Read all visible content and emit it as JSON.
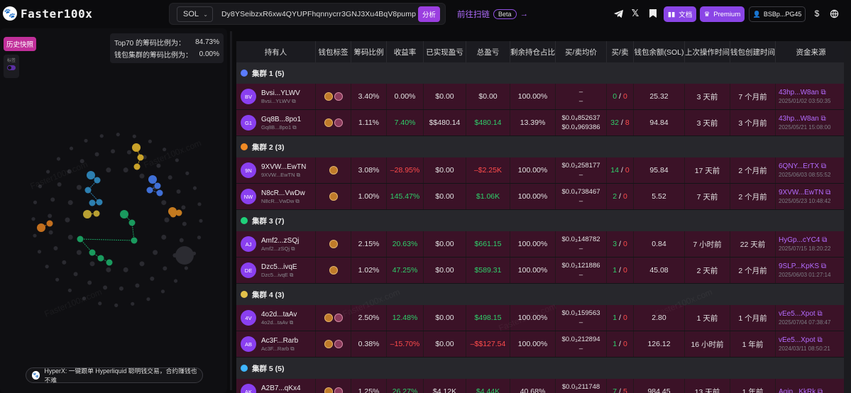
{
  "brand": {
    "name": "Faster100x"
  },
  "search": {
    "chain": "SOL",
    "address": "Dy8YSeibzxR6xw4QYUPFhqnnycrr3GNJ3Xu4BqV8pump",
    "analyze_label": "分析"
  },
  "scan": {
    "label": "前往扫链",
    "beta": "Beta"
  },
  "header": {
    "docs_label": "文档",
    "premium_label": "Premium",
    "wallet_label": "BSBp...PG45"
  },
  "left": {
    "history_label": "历史快照",
    "tag_label": "标签",
    "top70_label": "Top70 的筹码比例为：",
    "top70_value": "84.73%",
    "cluster_label": "钱包集群的筹码比例为：",
    "cluster_value": "0.00%",
    "notice": "HyperX: 一键跟单 Hyperliquid 聪明钱交易，合约赚钱也不难"
  },
  "table": {
    "headers": [
      "持有人",
      "钱包标签",
      "筹码比例",
      "收益率",
      "已实现盈亏",
      "总盈亏",
      "剩余持仓占比",
      "买/卖均价",
      "买/卖",
      "钱包余额(SOL)",
      "上次操作时间",
      "钱包创建时间",
      "资金来源"
    ],
    "clusters": [
      {
        "label": "集群 1 (5)",
        "color": "#5b7cff",
        "rows": [
          {
            "avatar": "BV",
            "name": "Bvsi...YLWV",
            "sub": "Bvsi...YLWV",
            "tags": 2,
            "ratio": "3.40%",
            "roi": "0.00%",
            "roi_c": "",
            "realized": "$0.00",
            "real_c": "",
            "total": "$0.00",
            "total_c": "",
            "remain": "100.00%",
            "avg_buy": "–",
            "avg_sell": "–",
            "buys": "0",
            "sells": "0",
            "balance": "25.32",
            "last": "3 天前",
            "created": "7 个月前",
            "src": "43hp...W8an",
            "src_date": "2025/01/02 03:50:35"
          },
          {
            "avatar": "G1",
            "name": "Gq8B...8po1",
            "sub": "Gq8B...8po1",
            "tags": 2,
            "ratio": "1.11%",
            "roi": "7.40%",
            "roi_c": "green",
            "realized": "$$480.14",
            "real_c": "",
            "total": "$480.14",
            "total_c": "green",
            "remain": "13.39%",
            "avg_buy": "$0.0₄852637",
            "avg_sell": "$0.0₄969386",
            "buys": "32",
            "sells": "8",
            "balance": "94.84",
            "last": "3 天前",
            "created": "3 个月前",
            "src": "43hp...W8an",
            "src_date": "2025/05/21 15:08:00"
          }
        ]
      },
      {
        "label": "集群 2 (3)",
        "color": "#f08a24",
        "rows": [
          {
            "avatar": "9N",
            "name": "9XVW...EwTN",
            "sub": "9XVW...EwTN",
            "tags": 1,
            "ratio": "3.08%",
            "roi": "–28.95%",
            "roi_c": "red",
            "realized": "$0.00",
            "real_c": "",
            "total": "–$2.25K",
            "total_c": "red",
            "remain": "100.00%",
            "avg_buy": "$0.0₃258177",
            "avg_sell": "–",
            "buys": "14",
            "sells": "0",
            "balance": "95.84",
            "last": "17 天前",
            "created": "2 个月前",
            "src": "6QNY...ErTX",
            "src_date": "2025/06/03 08:55:52"
          },
          {
            "avatar": "NW",
            "name": "N8cR...VwDw",
            "sub": "N8cR...VwDw",
            "tags": 1,
            "ratio": "1.00%",
            "roi": "145.47%",
            "roi_c": "green",
            "realized": "$0.00",
            "real_c": "",
            "total": "$1.06K",
            "total_c": "green",
            "remain": "100.00%",
            "avg_buy": "$0.0₄738467",
            "avg_sell": "–",
            "buys": "2",
            "sells": "0",
            "balance": "5.52",
            "last": "7 天前",
            "created": "2 个月前",
            "src": "9XVW...EwTN",
            "src_date": "2025/05/23 10:48:42"
          }
        ]
      },
      {
        "label": "集群 3 (7)",
        "color": "#1fd17a",
        "rows": [
          {
            "avatar": "AJ",
            "name": "Amf2...zSQj",
            "sub": "Amf2...zSQj",
            "tags": 1,
            "ratio": "2.15%",
            "roi": "20.63%",
            "roi_c": "green",
            "realized": "$0.00",
            "real_c": "",
            "total": "$661.15",
            "total_c": "green",
            "remain": "100.00%",
            "avg_buy": "$0.0₃148782",
            "avg_sell": "–",
            "buys": "3",
            "sells": "0",
            "balance": "0.84",
            "last": "7 小时前",
            "created": "22 天前",
            "src": "HyGp...cYC4",
            "src_date": "2025/07/15 18:20:22"
          },
          {
            "avatar": "DE",
            "name": "Dzc5...ivqE",
            "sub": "Dzc5...ivqE",
            "tags": 1,
            "ratio": "1.02%",
            "roi": "47.25%",
            "roi_c": "green",
            "realized": "$0.00",
            "real_c": "",
            "total": "$589.31",
            "total_c": "green",
            "remain": "100.00%",
            "avg_buy": "$0.0₃121886",
            "avg_sell": "–",
            "buys": "1",
            "sells": "0",
            "balance": "45.08",
            "last": "2 天前",
            "created": "2 个月前",
            "src": "9SLP...KpKS",
            "src_date": "2025/06/03 01:27:14"
          }
        ]
      },
      {
        "label": "集群 4 (3)",
        "color": "#e3c24a",
        "rows": [
          {
            "avatar": "4V",
            "name": "4o2d...taAv",
            "sub": "4o2d...taAv",
            "tags": 2,
            "ratio": "2.50%",
            "roi": "12.48%",
            "roi_c": "green",
            "realized": "$0.00",
            "real_c": "",
            "total": "$498.15",
            "total_c": "green",
            "remain": "100.00%",
            "avg_buy": "$0.0₃159563",
            "avg_sell": "–",
            "buys": "1",
            "sells": "0",
            "balance": "2.80",
            "last": "1 天前",
            "created": "1 个月前",
            "src": "vEe5...Xpot",
            "src_date": "2025/07/04 07:38:47"
          },
          {
            "avatar": "AB",
            "name": "Ac3F...Rarb",
            "sub": "Ac3F...Rarb",
            "tags": 2,
            "ratio": "0.38%",
            "roi": "–15.70%",
            "roi_c": "red",
            "realized": "$0.00",
            "real_c": "",
            "total": "–$$127.54",
            "total_c": "red",
            "remain": "100.00%",
            "avg_buy": "$0.0₃212894",
            "avg_sell": "–",
            "buys": "1",
            "sells": "0",
            "balance": "126.12",
            "last": "16 小时前",
            "created": "1 年前",
            "src": "vEe5...Xpot",
            "src_date": "2024/03/11 08:50:21"
          }
        ]
      },
      {
        "label": "集群 5 (5)",
        "color": "#3fb6ff",
        "rows": [
          {
            "avatar": "AK",
            "name": "A2B7...qKx4",
            "sub": "A2B7...qKx4",
            "tags": 2,
            "ratio": "1.25%",
            "roi": "26.27%",
            "roi_c": "green",
            "realized": "$4.12K",
            "real_c": "",
            "total": "$4.44K",
            "total_c": "green",
            "remain": "40.68%",
            "avg_buy": "$0.0₃211748",
            "avg_sell": "–",
            "buys": "7",
            "sells": "5",
            "balance": "984.45",
            "last": "13 天前",
            "created": "1 年前",
            "src": "Aqip...KkRk",
            "src_date": ""
          }
        ]
      }
    ]
  }
}
